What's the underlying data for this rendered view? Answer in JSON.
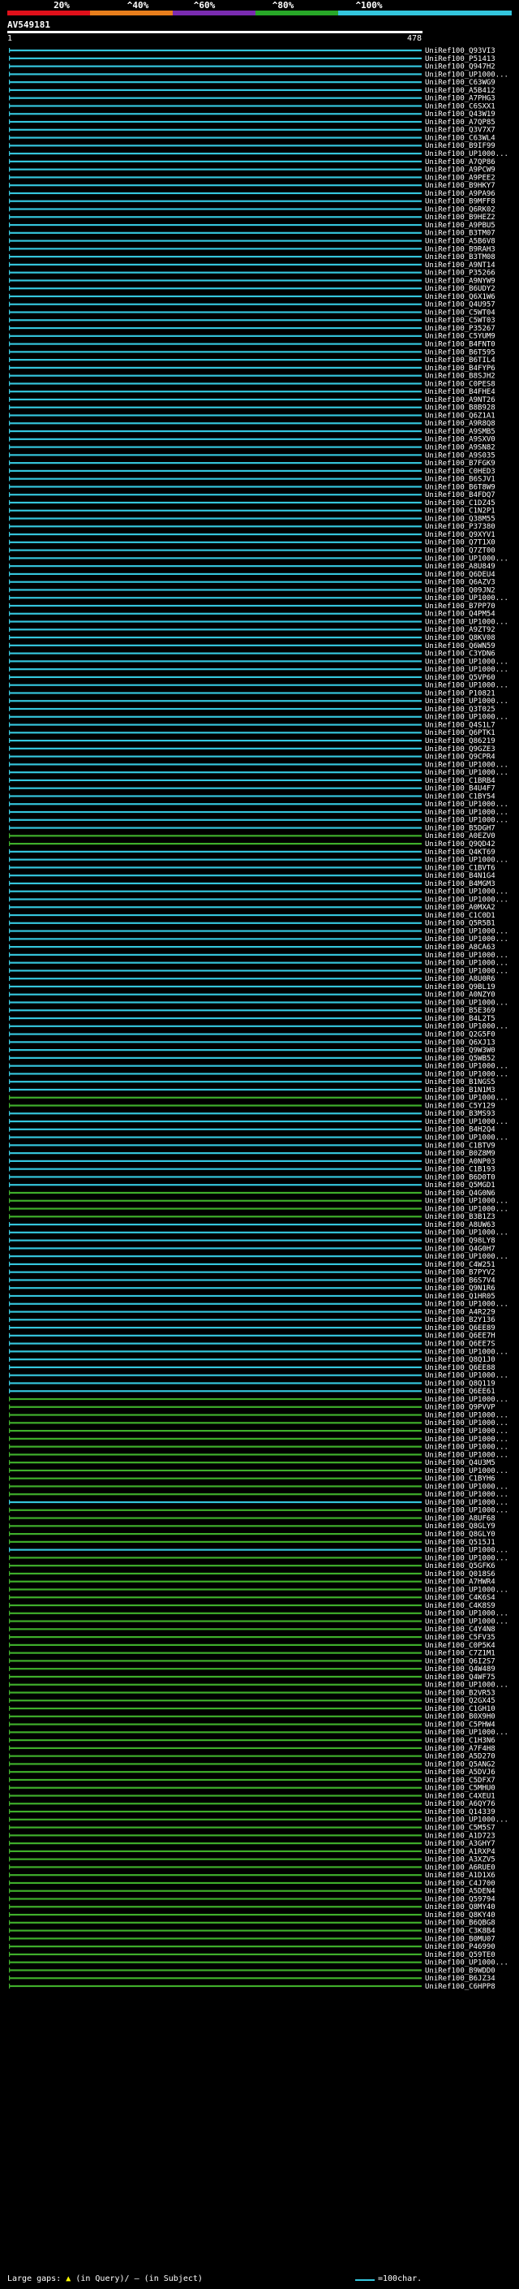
{
  "query": {
    "name": "AV549181",
    "start": "1",
    "end": "478"
  },
  "scale_bar": {
    "labels": [
      "20%",
      "^40%",
      "^60%",
      "^80%",
      "^100%"
    ],
    "colors": [
      "#e0101a",
      "#e87e1c",
      "#7a2bb0",
      "#28a828",
      "#33c5dd"
    ]
  },
  "footer": {
    "large_gaps_label": "Large gaps:",
    "query_gap_label": "(in Query)/",
    "subject_gap_label": "(in Subject)",
    "legend_label": "=100char."
  },
  "colors": {
    "cyan": "#35c5dc",
    "green": "#3fae2b",
    "black": "#000000",
    "white": "#ffffff"
  },
  "chart_data": {
    "type": "alignment-map",
    "x_range": [
      1,
      478
    ],
    "hits": [
      {
        "id": "UniRef100_Q93VI3",
        "color": "cyan"
      },
      {
        "id": "UniRef100_P51413",
        "color": "cyan"
      },
      {
        "id": "UniRef100_Q947H2",
        "color": "cyan"
      },
      {
        "id": "UniRef100_UP1000...",
        "color": "cyan"
      },
      {
        "id": "UniRef100_C63WG9",
        "color": "cyan"
      },
      {
        "id": "UniRef100_A5B412",
        "color": "cyan"
      },
      {
        "id": "UniRef100_A7PHG3",
        "color": "cyan"
      },
      {
        "id": "UniRef100_C6SXX1",
        "color": "cyan"
      },
      {
        "id": "UniRef100_Q43W19",
        "color": "cyan"
      },
      {
        "id": "UniRef100_A7QP85",
        "color": "cyan"
      },
      {
        "id": "UniRef100_Q3V7X7",
        "color": "cyan"
      },
      {
        "id": "UniRef100_C63WL4",
        "color": "cyan"
      },
      {
        "id": "UniRef100_B9IF99",
        "color": "cyan"
      },
      {
        "id": "UniRef100_UP1000...",
        "color": "cyan"
      },
      {
        "id": "UniRef100_A7QP86",
        "color": "cyan"
      },
      {
        "id": "UniRef100_A9PCW9",
        "color": "cyan"
      },
      {
        "id": "UniRef100_A9PEE2",
        "color": "cyan"
      },
      {
        "id": "UniRef100_B9HKY7",
        "color": "cyan"
      },
      {
        "id": "UniRef100_A9PA96",
        "color": "cyan"
      },
      {
        "id": "UniRef100_B9MFF8",
        "color": "cyan"
      },
      {
        "id": "UniRef100_Q6RK02",
        "color": "cyan"
      },
      {
        "id": "UniRef100_B9HEZ2",
        "color": "cyan"
      },
      {
        "id": "UniRef100_A9PBU5",
        "color": "cyan"
      },
      {
        "id": "UniRef100_B3TM07",
        "color": "cyan"
      },
      {
        "id": "UniRef100_A5B6V8",
        "color": "cyan"
      },
      {
        "id": "UniRef100_B9RAH3",
        "color": "cyan"
      },
      {
        "id": "UniRef100_B3TM08",
        "color": "cyan"
      },
      {
        "id": "UniRef100_A9NT14",
        "color": "cyan"
      },
      {
        "id": "UniRef100_P35266",
        "color": "cyan"
      },
      {
        "id": "UniRef100_A9NYW9",
        "color": "cyan"
      },
      {
        "id": "UniRef100_B6UDY2",
        "color": "cyan"
      },
      {
        "id": "UniRef100_Q6X1W6",
        "color": "cyan"
      },
      {
        "id": "UniRef100_Q4U957",
        "color": "cyan"
      },
      {
        "id": "UniRef100_C5WT04",
        "color": "cyan"
      },
      {
        "id": "UniRef100_C5WT03",
        "color": "cyan"
      },
      {
        "id": "UniRef100_P35267",
        "color": "cyan"
      },
      {
        "id": "UniRef100_C5YUM9",
        "color": "cyan"
      },
      {
        "id": "UniRef100_B4FNT0",
        "color": "cyan"
      },
      {
        "id": "UniRef100_B6T595",
        "color": "cyan"
      },
      {
        "id": "UniRef100_B6TIL4",
        "color": "cyan"
      },
      {
        "id": "UniRef100_B4FYP6",
        "color": "cyan"
      },
      {
        "id": "UniRef100_B8SJH2",
        "color": "cyan"
      },
      {
        "id": "UniRef100_C0PES8",
        "color": "cyan"
      },
      {
        "id": "UniRef100_B4FHE4",
        "color": "cyan"
      },
      {
        "id": "UniRef100_A9NT26",
        "color": "cyan"
      },
      {
        "id": "UniRef100_B8B928",
        "color": "cyan"
      },
      {
        "id": "UniRef100_Q6Z1A1",
        "color": "cyan"
      },
      {
        "id": "UniRef100_A9R8Q8",
        "color": "cyan"
      },
      {
        "id": "UniRef100_A9SMB5",
        "color": "cyan"
      },
      {
        "id": "UniRef100_A9SXV0",
        "color": "cyan"
      },
      {
        "id": "UniRef100_A9SN82",
        "color": "cyan"
      },
      {
        "id": "UniRef100_A9S035",
        "color": "cyan"
      },
      {
        "id": "UniRef100_B7FGK9",
        "color": "cyan"
      },
      {
        "id": "UniRef100_C0HED3",
        "color": "cyan"
      },
      {
        "id": "UniRef100_B6SJV1",
        "color": "cyan"
      },
      {
        "id": "UniRef100_B6T8W9",
        "color": "cyan"
      },
      {
        "id": "UniRef100_B4FDQ7",
        "color": "cyan"
      },
      {
        "id": "UniRef100_C1DZ45",
        "color": "cyan"
      },
      {
        "id": "UniRef100_C1N2P1",
        "color": "cyan"
      },
      {
        "id": "UniRef100_Q38M55",
        "color": "cyan"
      },
      {
        "id": "UniRef100_P37380",
        "color": "cyan"
      },
      {
        "id": "UniRef100_Q9XYV1",
        "color": "cyan"
      },
      {
        "id": "UniRef100_Q7T1X0",
        "color": "cyan"
      },
      {
        "id": "UniRef100_Q7ZT00",
        "color": "cyan"
      },
      {
        "id": "UniRef100_UP1000...",
        "color": "cyan"
      },
      {
        "id": "UniRef100_A8U849",
        "color": "cyan"
      },
      {
        "id": "UniRef100_Q6DEU4",
        "color": "cyan"
      },
      {
        "id": "UniRef100_Q6AZV3",
        "color": "cyan"
      },
      {
        "id": "UniRef100_Q09JN2",
        "color": "cyan"
      },
      {
        "id": "UniRef100_UP1000...",
        "color": "cyan"
      },
      {
        "id": "UniRef100_B7PP70",
        "color": "cyan"
      },
      {
        "id": "UniRef100_Q4PM54",
        "color": "cyan"
      },
      {
        "id": "UniRef100_UP1000...",
        "color": "cyan"
      },
      {
        "id": "UniRef100_A9ZT92",
        "color": "cyan"
      },
      {
        "id": "UniRef100_Q8KV08",
        "color": "cyan"
      },
      {
        "id": "UniRef100_Q6WN59",
        "color": "cyan"
      },
      {
        "id": "UniRef100_C3YDN6",
        "color": "cyan"
      },
      {
        "id": "UniRef100_UP1000...",
        "color": "cyan"
      },
      {
        "id": "UniRef100_UP1000...",
        "color": "cyan"
      },
      {
        "id": "UniRef100_Q5VP60",
        "color": "cyan"
      },
      {
        "id": "UniRef100_UP1000...",
        "color": "cyan"
      },
      {
        "id": "UniRef100_P10821",
        "color": "cyan"
      },
      {
        "id": "UniRef100_UP1000...",
        "color": "cyan"
      },
      {
        "id": "UniRef100_Q3T025",
        "color": "cyan"
      },
      {
        "id": "UniRef100_UP1000...",
        "color": "cyan"
      },
      {
        "id": "UniRef100_Q4S1L7",
        "color": "cyan"
      },
      {
        "id": "UniRef100_Q6PTK1",
        "color": "cyan"
      },
      {
        "id": "UniRef100_Q86219",
        "color": "cyan"
      },
      {
        "id": "UniRef100_Q9GZE3",
        "color": "cyan"
      },
      {
        "id": "UniRef100_Q9CPR4",
        "color": "cyan"
      },
      {
        "id": "UniRef100_UP1000...",
        "color": "cyan"
      },
      {
        "id": "UniRef100_UP1000...",
        "color": "cyan"
      },
      {
        "id": "UniRef100_C1BRB4",
        "color": "cyan"
      },
      {
        "id": "UniRef100_B4U4F7",
        "color": "cyan"
      },
      {
        "id": "UniRef100_C1BY54",
        "color": "cyan"
      },
      {
        "id": "UniRef100_UP1000...",
        "color": "cyan"
      },
      {
        "id": "UniRef100_UP1000...",
        "color": "cyan"
      },
      {
        "id": "UniRef100_UP1000...",
        "color": "cyan"
      },
      {
        "id": "UniRef100_B5DGH7",
        "color": "cyan"
      },
      {
        "id": "UniRef100_A0EZV0",
        "color": "green"
      },
      {
        "id": "UniRef100_Q9QD42",
        "color": "green"
      },
      {
        "id": "UniRef100_Q4KT69",
        "color": "cyan"
      },
      {
        "id": "UniRef100_UP1000...",
        "color": "cyan"
      },
      {
        "id": "UniRef100_C1BVT6",
        "color": "cyan"
      },
      {
        "id": "UniRef100_B4N1G4",
        "color": "cyan"
      },
      {
        "id": "UniRef100_B4MGM3",
        "color": "cyan"
      },
      {
        "id": "UniRef100_UP1000...",
        "color": "cyan"
      },
      {
        "id": "UniRef100_UP1000...",
        "color": "cyan"
      },
      {
        "id": "UniRef100_A0MXA2",
        "color": "cyan"
      },
      {
        "id": "UniRef100_C1C0D1",
        "color": "cyan"
      },
      {
        "id": "UniRef100_Q5R5B1",
        "color": "cyan"
      },
      {
        "id": "UniRef100_UP1000...",
        "color": "cyan"
      },
      {
        "id": "UniRef100_UP1000...",
        "color": "cyan"
      },
      {
        "id": "UniRef100_A8CA63",
        "color": "cyan"
      },
      {
        "id": "UniRef100_UP1000...",
        "color": "cyan"
      },
      {
        "id": "UniRef100_UP1000...",
        "color": "cyan"
      },
      {
        "id": "UniRef100_UP1000...",
        "color": "cyan"
      },
      {
        "id": "UniRef100_A8U0R6",
        "color": "cyan"
      },
      {
        "id": "UniRef100_Q9BL19",
        "color": "cyan"
      },
      {
        "id": "UniRef100_A0NZY0",
        "color": "cyan"
      },
      {
        "id": "UniRef100_UP1000...",
        "color": "cyan"
      },
      {
        "id": "UniRef100_B5E369",
        "color": "cyan"
      },
      {
        "id": "UniRef100_B4L2T5",
        "color": "cyan"
      },
      {
        "id": "UniRef100_UP1000...",
        "color": "cyan"
      },
      {
        "id": "UniRef100_Q2G5F0",
        "color": "cyan"
      },
      {
        "id": "UniRef100_Q6XJ13",
        "color": "cyan"
      },
      {
        "id": "UniRef100_Q9W3W0",
        "color": "cyan"
      },
      {
        "id": "UniRef100_Q5WB52",
        "color": "cyan"
      },
      {
        "id": "UniRef100_UP1000...",
        "color": "cyan"
      },
      {
        "id": "UniRef100_UP1000...",
        "color": "cyan"
      },
      {
        "id": "UniRef100_B1NGS5",
        "color": "cyan"
      },
      {
        "id": "UniRef100_B1N1M3",
        "color": "cyan"
      },
      {
        "id": "UniRef100_UP1000...",
        "color": "green"
      },
      {
        "id": "UniRef100_C5Y129",
        "color": "green"
      },
      {
        "id": "UniRef100_B3MS93",
        "color": "cyan"
      },
      {
        "id": "UniRef100_UP1000...",
        "color": "cyan"
      },
      {
        "id": "UniRef100_B4H2Q4",
        "color": "cyan"
      },
      {
        "id": "UniRef100_UP1000...",
        "color": "cyan"
      },
      {
        "id": "UniRef100_C1BTV9",
        "color": "cyan"
      },
      {
        "id": "UniRef100_B0Z8M9",
        "color": "cyan"
      },
      {
        "id": "UniRef100_A0NP03",
        "color": "cyan"
      },
      {
        "id": "UniRef100_C1B193",
        "color": "cyan"
      },
      {
        "id": "UniRef100_B6D0T0",
        "color": "cyan"
      },
      {
        "id": "UniRef100_Q5MGD1",
        "color": "cyan"
      },
      {
        "id": "UniRef100_Q4G0N6",
        "color": "green"
      },
      {
        "id": "UniRef100_UP1000...",
        "color": "green"
      },
      {
        "id": "UniRef100_UP1000...",
        "color": "green"
      },
      {
        "id": "UniRef100_B3B1Z3",
        "color": "green"
      },
      {
        "id": "UniRef100_A8UW63",
        "color": "cyan"
      },
      {
        "id": "UniRef100_UP1000...",
        "color": "cyan"
      },
      {
        "id": "UniRef100_Q98LY8",
        "color": "cyan"
      },
      {
        "id": "UniRef100_Q4G0H7",
        "color": "cyan"
      },
      {
        "id": "UniRef100_UP1000...",
        "color": "cyan"
      },
      {
        "id": "UniRef100_C4W251",
        "color": "cyan"
      },
      {
        "id": "UniRef100_B7PYV2",
        "color": "cyan"
      },
      {
        "id": "UniRef100_B6S7V4",
        "color": "cyan"
      },
      {
        "id": "UniRef100_Q9N1R6",
        "color": "cyan"
      },
      {
        "id": "UniRef100_Q1HR05",
        "color": "cyan"
      },
      {
        "id": "UniRef100_UP1000...",
        "color": "cyan"
      },
      {
        "id": "UniRef100_A4R229",
        "color": "cyan"
      },
      {
        "id": "UniRef100_B2Y136",
        "color": "cyan"
      },
      {
        "id": "UniRef100_Q6EE89",
        "color": "cyan"
      },
      {
        "id": "UniRef100_Q6EE7H",
        "color": "cyan"
      },
      {
        "id": "UniRef100_Q6EE7S",
        "color": "cyan"
      },
      {
        "id": "UniRef100_UP1000...",
        "color": "cyan"
      },
      {
        "id": "UniRef100_Q8Q1J0",
        "color": "cyan"
      },
      {
        "id": "UniRef100_Q6EE88",
        "color": "cyan"
      },
      {
        "id": "UniRef100_UP1000...",
        "color": "cyan"
      },
      {
        "id": "UniRef100_Q8Q119",
        "color": "cyan"
      },
      {
        "id": "UniRef100_Q6EE61",
        "color": "cyan"
      },
      {
        "id": "UniRef100_UP1000...",
        "color": "green"
      },
      {
        "id": "UniRef100_Q9PVVP",
        "color": "green"
      },
      {
        "id": "UniRef100_UP1000...",
        "color": "green"
      },
      {
        "id": "UniRef100_UP1000...",
        "color": "green"
      },
      {
        "id": "UniRef100_UP1000...",
        "color": "green"
      },
      {
        "id": "UniRef100_UP1000...",
        "color": "green"
      },
      {
        "id": "UniRef100_UP1000...",
        "color": "green"
      },
      {
        "id": "UniRef100_UP1000...",
        "color": "green"
      },
      {
        "id": "UniRef100_Q4U3M5",
        "color": "green"
      },
      {
        "id": "UniRef100_UP1000...",
        "color": "green"
      },
      {
        "id": "UniRef100_C1BYH6",
        "color": "green"
      },
      {
        "id": "UniRef100_UP1000...",
        "color": "green"
      },
      {
        "id": "UniRef100_UP1000...",
        "color": "green"
      },
      {
        "id": "UniRef100_UP1000...",
        "color": "cyan"
      },
      {
        "id": "UniRef100_UP1000...",
        "color": "green"
      },
      {
        "id": "UniRef100_A8UF68",
        "color": "green"
      },
      {
        "id": "UniRef100_Q8GLY9",
        "color": "green"
      },
      {
        "id": "UniRef100_Q8GLY0",
        "color": "green"
      },
      {
        "id": "UniRef100_Q515J1",
        "color": "green"
      },
      {
        "id": "UniRef100_UP1000...",
        "color": "cyan"
      },
      {
        "id": "UniRef100_UP1000...",
        "color": "green"
      },
      {
        "id": "UniRef100_Q5GFK6",
        "color": "green"
      },
      {
        "id": "UniRef100_Q018S6",
        "color": "green"
      },
      {
        "id": "UniRef100_A7HWR4",
        "color": "green"
      },
      {
        "id": "UniRef100_UP1000...",
        "color": "green"
      },
      {
        "id": "UniRef100_C4K6S4",
        "color": "green"
      },
      {
        "id": "UniRef100_C4K8S9",
        "color": "green"
      },
      {
        "id": "UniRef100_UP1000...",
        "color": "green"
      },
      {
        "id": "UniRef100_UP1000...",
        "color": "green"
      },
      {
        "id": "UniRef100_C4Y4N8",
        "color": "green"
      },
      {
        "id": "UniRef100_C5FV35",
        "color": "green"
      },
      {
        "id": "UniRef100_C0P5K4",
        "color": "green"
      },
      {
        "id": "UniRef100_C7Z1M1",
        "color": "green"
      },
      {
        "id": "UniRef100_Q6I2S7",
        "color": "green"
      },
      {
        "id": "UniRef100_Q4W489",
        "color": "green"
      },
      {
        "id": "UniRef100_Q4WF75",
        "color": "green"
      },
      {
        "id": "UniRef100_UP1000...",
        "color": "green"
      },
      {
        "id": "UniRef100_B2VR53",
        "color": "green"
      },
      {
        "id": "UniRef100_Q2GX45",
        "color": "green"
      },
      {
        "id": "UniRef100_C1GH10",
        "color": "green"
      },
      {
        "id": "UniRef100_B0X9H0",
        "color": "green"
      },
      {
        "id": "UniRef100_C5PHW4",
        "color": "green"
      },
      {
        "id": "UniRef100_UP1000...",
        "color": "green"
      },
      {
        "id": "UniRef100_C1H3N6",
        "color": "green"
      },
      {
        "id": "UniRef100_A7F4H8",
        "color": "green"
      },
      {
        "id": "UniRef100_A5D270",
        "color": "green"
      },
      {
        "id": "UniRef100_Q5ANG2",
        "color": "green"
      },
      {
        "id": "UniRef100_A5DVJ6",
        "color": "green"
      },
      {
        "id": "UniRef100_C5DFX7",
        "color": "green"
      },
      {
        "id": "UniRef100_C5MHU0",
        "color": "green"
      },
      {
        "id": "UniRef100_C4XEU1",
        "color": "green"
      },
      {
        "id": "UniRef100_A6QY76",
        "color": "green"
      },
      {
        "id": "UniRef100_Q14339",
        "color": "green"
      },
      {
        "id": "UniRef100_UP1000...",
        "color": "green"
      },
      {
        "id": "UniRef100_C5M5S7",
        "color": "green"
      },
      {
        "id": "UniRef100_A1D723",
        "color": "green"
      },
      {
        "id": "UniRef100_A3GHY7",
        "color": "green"
      },
      {
        "id": "UniRef100_A1RXP4",
        "color": "green"
      },
      {
        "id": "UniRef100_A3XZV5",
        "color": "green"
      },
      {
        "id": "UniRef100_A6RUE0",
        "color": "green"
      },
      {
        "id": "UniRef100_A1D1X6",
        "color": "green"
      },
      {
        "id": "UniRef100_C4J700",
        "color": "green"
      },
      {
        "id": "UniRef100_A5DEN4",
        "color": "green"
      },
      {
        "id": "UniRef100_Q59794",
        "color": "green"
      },
      {
        "id": "UniRef100_Q8MY40",
        "color": "green"
      },
      {
        "id": "UniRef100_Q8KY40",
        "color": "green"
      },
      {
        "id": "UniRef100_B6QBG8",
        "color": "green"
      },
      {
        "id": "UniRef100_C3K8B4",
        "color": "green"
      },
      {
        "id": "UniRef100_B0MU07",
        "color": "green"
      },
      {
        "id": "UniRef100_P46990",
        "color": "green"
      },
      {
        "id": "UniRef100_Q59TE0",
        "color": "green"
      },
      {
        "id": "UniRef100_UP1000...",
        "color": "green"
      },
      {
        "id": "UniRef100_B9WDD0",
        "color": "green"
      },
      {
        "id": "UniRef100_B6JZ34",
        "color": "green"
      },
      {
        "id": "UniRef100_C6HPP8",
        "color": "green"
      }
    ]
  }
}
